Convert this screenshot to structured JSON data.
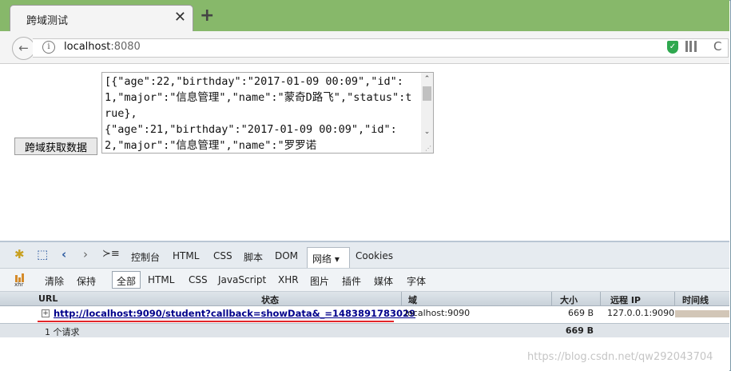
{
  "tab": {
    "title": "跨域测试",
    "close_glyph": "✕",
    "new_tab_glyph": "+"
  },
  "navbar": {
    "host": "localhost",
    "port": ":8080",
    "info_glyph": "i",
    "back_glyph": "←",
    "reload_glyph": "C"
  },
  "page": {
    "button_label": "跨域获取数据",
    "textarea_text": "[{\"age\":22,\"birthday\":\"2017-01-09 00:09\",\"id\":1,\"major\":\"信息管理\",\"name\":\"蒙奇D路飞\",\"status\":true},\n{\"age\":21,\"birthday\":\"2017-01-09 00:09\",\"id\":2,\"major\":\"信息管理\",\"name\":\"罗罗诺"
  },
  "devtools": {
    "tabs": [
      "控制台",
      "HTML",
      "CSS",
      "脚本",
      "DOM",
      "网络",
      "Cookies"
    ],
    "active_tab": "网络 ▾",
    "filters": [
      "清除",
      "保持",
      "全部",
      "HTML",
      "CSS",
      "JavaScript",
      "XHR",
      "图片",
      "插件",
      "媒体",
      "字体"
    ],
    "columns": {
      "url": "URL",
      "status": "状态",
      "domain": "域",
      "size": "大小",
      "remote_ip": "远程 IP",
      "timeline": "时间线"
    },
    "request": {
      "url": "http://localhost:9090/student?callback=showData&_=1483891783029",
      "domain": "localhost:9090",
      "size": "669 B",
      "remote_ip": "127.0.0.1:9090"
    },
    "summary": {
      "count": "1 个请求",
      "total_size": "669 B"
    }
  },
  "watermark": "https://blog.csdn.net/qw292043704",
  "colors": {
    "tabstrip": "#87b86a",
    "link": "#00008b",
    "highlight_line": "#e3262a"
  }
}
